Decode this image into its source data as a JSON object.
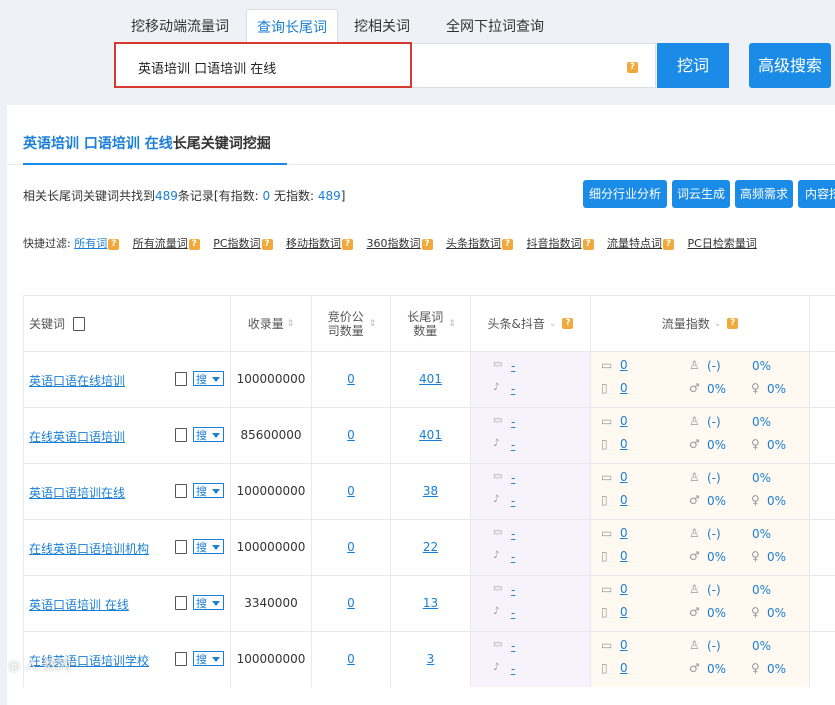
{
  "tabs": [
    "挖移动端流量词",
    "查询长尾词",
    "挖相关词",
    "全网下拉词查询"
  ],
  "search": {
    "value": "英语培训 口语培训 在线",
    "help": "?"
  },
  "buttons": {
    "dig": "挖词",
    "advanced": "高级搜索"
  },
  "panel": {
    "title_highlight": "英语培训 口语培训 在线",
    "title_rest": "长尾关键词挖掘",
    "summary": {
      "prefix": "相关长尾词关键词共找到",
      "total": "489",
      "mid": "条记录[有指数:",
      "with_index": "0",
      "mid2": "无指数:",
      "no_index": "489",
      "suffix": "]"
    },
    "action_buttons": [
      "细分行业分析",
      "词云生成",
      "高频需求",
      "内容挖"
    ],
    "filter_label": "快捷过滤:",
    "filters": [
      "所有词",
      "所有流量词",
      "PC指数词",
      "移动指数词",
      "360指数词",
      "头条指数词",
      "抖音指数词",
      "流量特点词",
      "PC日检索量词"
    ]
  },
  "table": {
    "headers": {
      "keyword": "关键词",
      "index_count": "收录量",
      "bid": "竞价公司数量",
      "longtail": "长尾词数量",
      "toutiao": "头条&抖音",
      "traffic": "流量指数"
    },
    "rows": [
      {
        "keyword": "英语口语在线培训",
        "search_btn": "搜",
        "count": "100000000",
        "bid": "0",
        "longtail": "401",
        "tt": "-",
        "dy": "-",
        "pc": "0",
        "mobile": "0",
        "male": "(-)",
        "male_pct": "0%",
        "female_pct": "0%",
        "female_pct2": "0%",
        "pct3": "0%"
      },
      {
        "keyword": "在线英语口语培训",
        "search_btn": "搜",
        "count": "85600000",
        "bid": "0",
        "longtail": "401",
        "tt": "-",
        "dy": "-",
        "pc": "0",
        "mobile": "0",
        "male": "(-)",
        "male_pct": "0%",
        "female_pct": "0%",
        "female_pct2": "0%",
        "pct3": "0%"
      },
      {
        "keyword": "英语口语培训在线",
        "search_btn": "搜",
        "count": "100000000",
        "bid": "0",
        "longtail": "38",
        "tt": "-",
        "dy": "-",
        "pc": "0",
        "mobile": "0",
        "male": "(-)",
        "male_pct": "0%",
        "female_pct": "0%",
        "female_pct2": "0%",
        "pct3": "0%"
      },
      {
        "keyword": "在线英语口语培训机构",
        "search_btn": "搜",
        "count": "100000000",
        "bid": "0",
        "longtail": "22",
        "tt": "-",
        "dy": "-",
        "pc": "0",
        "mobile": "0",
        "male": "(-)",
        "male_pct": "0%",
        "female_pct": "0%",
        "female_pct2": "0%",
        "pct3": "0%"
      },
      {
        "keyword": "英语口语培训 在线",
        "search_btn": "搜",
        "count": "3340000",
        "bid": "0",
        "longtail": "13",
        "tt": "-",
        "dy": "-",
        "pc": "0",
        "mobile": "0",
        "male": "(-)",
        "male_pct": "0%",
        "female_pct": "0%",
        "female_pct2": "0%",
        "pct3": "0%"
      },
      {
        "keyword": "在线英语口语培训学校",
        "search_btn": "搜",
        "count": "100000000",
        "bid": "0",
        "longtail": "3",
        "tt": "-",
        "dy": "-",
        "pc": "0",
        "mobile": "0",
        "male": "(-)",
        "male_pct": "0%",
        "female_pct": "0%",
        "female_pct2": "0%",
        "pct3": "0%"
      }
    ]
  },
  "colors": {
    "accent": "#1a8be6",
    "highlight_border": "#d63a2e",
    "help_badge": "#f2a93b"
  }
}
